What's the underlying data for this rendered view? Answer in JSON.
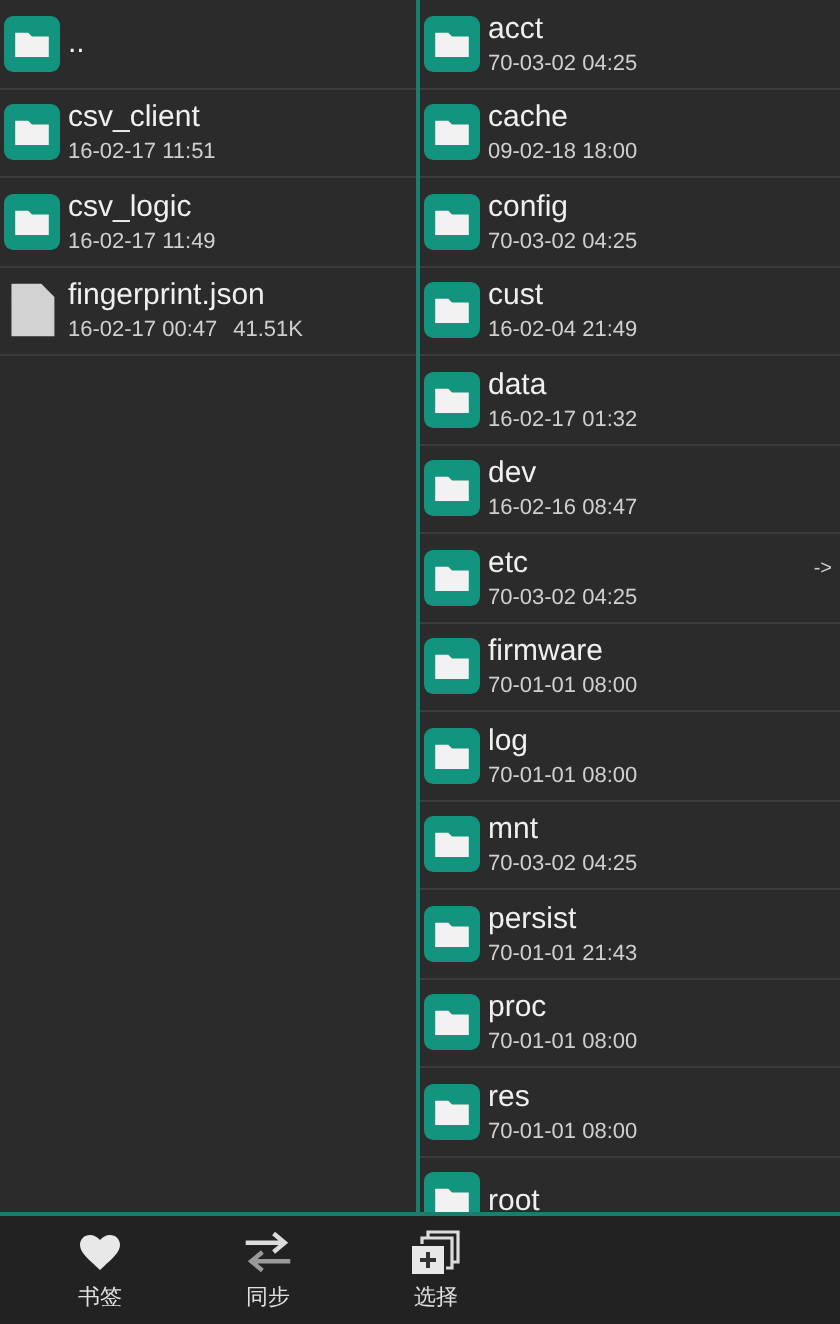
{
  "left_pane": {
    "items": [
      {
        "kind": "folder",
        "name": ".."
      },
      {
        "kind": "folder",
        "name": "csv_client",
        "date": "16-02-17 11:51"
      },
      {
        "kind": "folder",
        "name": "csv_logic",
        "date": "16-02-17 11:49"
      },
      {
        "kind": "file",
        "name": "fingerprint.json",
        "date": "16-02-17 00:47",
        "size": "41.51K"
      }
    ]
  },
  "right_pane": {
    "items": [
      {
        "kind": "folder",
        "name": "acct",
        "date": "70-03-02 04:25"
      },
      {
        "kind": "folder",
        "name": "cache",
        "date": "09-02-18 18:00"
      },
      {
        "kind": "folder",
        "name": "config",
        "date": "70-03-02 04:25"
      },
      {
        "kind": "folder",
        "name": "cust",
        "date": "16-02-04 21:49"
      },
      {
        "kind": "folder",
        "name": "data",
        "date": "16-02-17 01:32"
      },
      {
        "kind": "folder",
        "name": "dev",
        "date": "16-02-16 08:47"
      },
      {
        "kind": "folder",
        "name": "etc",
        "date": "70-03-02 04:25",
        "link_mark": "->"
      },
      {
        "kind": "folder",
        "name": "firmware",
        "date": "70-01-01 08:00"
      },
      {
        "kind": "folder",
        "name": "log",
        "date": "70-01-01 08:00"
      },
      {
        "kind": "folder",
        "name": "mnt",
        "date": "70-03-02 04:25"
      },
      {
        "kind": "folder",
        "name": "persist",
        "date": "70-01-01 21:43"
      },
      {
        "kind": "folder",
        "name": "proc",
        "date": "70-01-01 08:00"
      },
      {
        "kind": "folder",
        "name": "res",
        "date": "70-01-01 08:00"
      },
      {
        "kind": "folder",
        "name": "root"
      }
    ]
  },
  "toolbar": [
    {
      "kind": "bookmark",
      "label": "书签"
    },
    {
      "kind": "sync",
      "label": "同步"
    },
    {
      "kind": "select",
      "label": "选择"
    }
  ]
}
